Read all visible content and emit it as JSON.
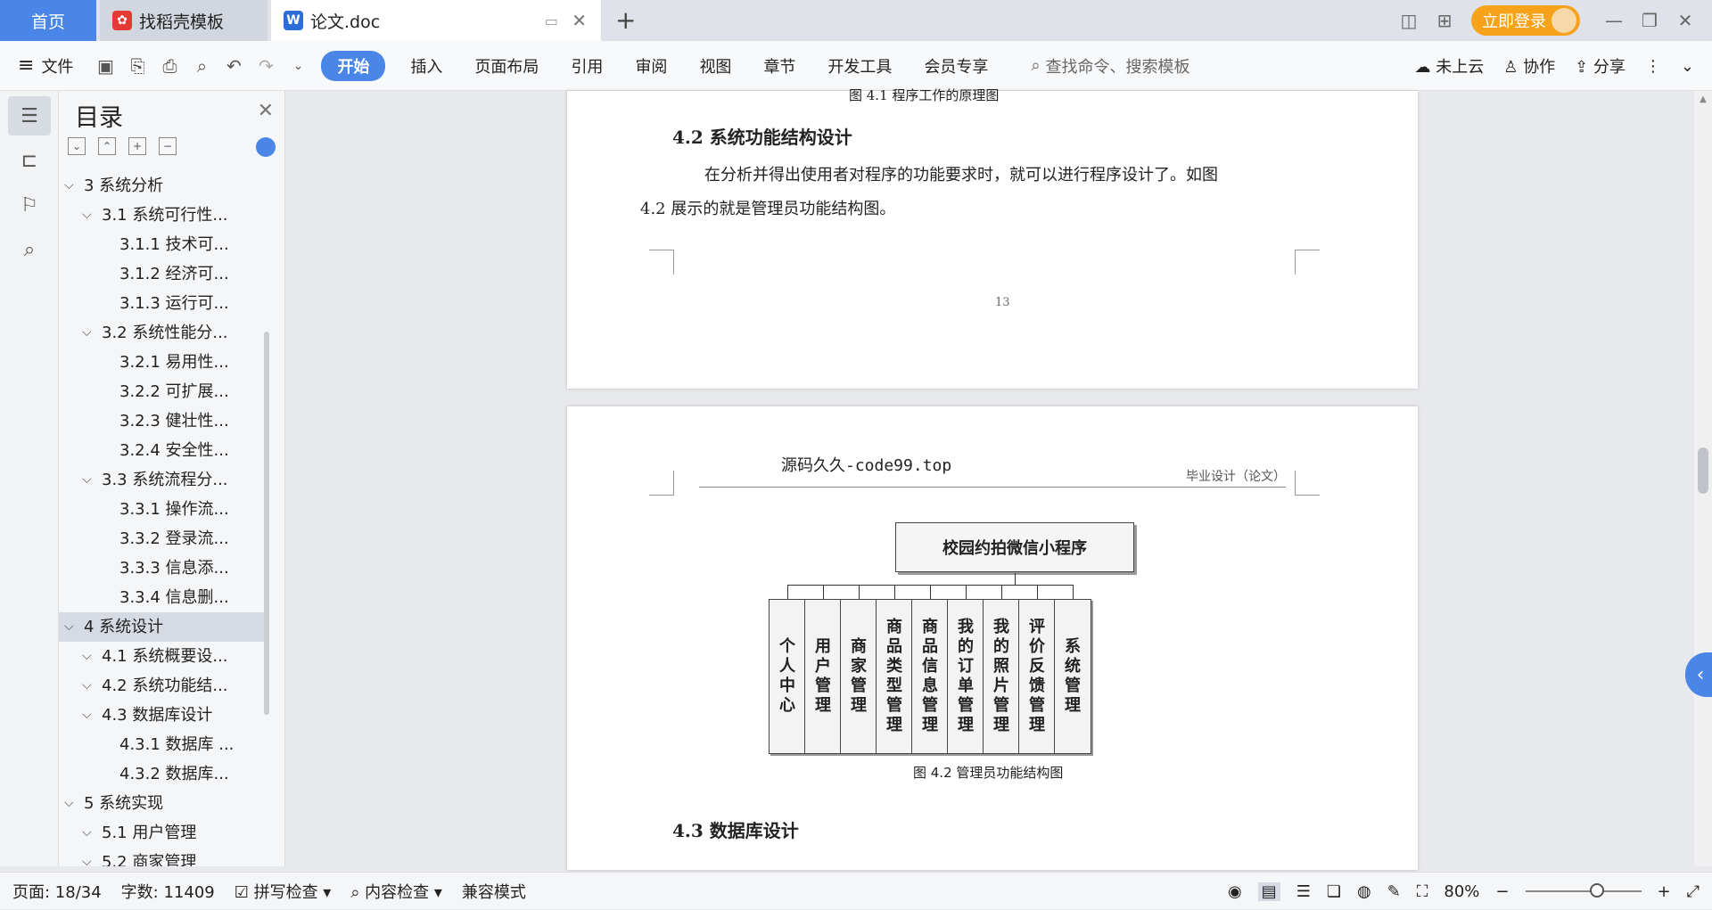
{
  "tabs": {
    "home": "首页",
    "template": "找稻壳模板",
    "document": "论文.doc"
  },
  "titlebar": {
    "login_label": "立即登录"
  },
  "toolbar": {
    "file_label": "文件",
    "menus": [
      "开始",
      "插入",
      "页面布局",
      "引用",
      "审阅",
      "视图",
      "章节",
      "开发工具",
      "会员专享"
    ],
    "search_placeholder": "查找命令、搜索模板",
    "cloud_label": "未上云",
    "collab_label": "协作",
    "share_label": "分享"
  },
  "toc": {
    "title": "目录",
    "items": [
      {
        "label": "3  系统分析",
        "level": 0,
        "expanded": true
      },
      {
        "label": "3.1  系统可行性...",
        "level": 1,
        "expanded": true
      },
      {
        "label": "3.1.1  技术可...",
        "level": 2
      },
      {
        "label": "3.1.2  经济可...",
        "level": 2
      },
      {
        "label": "3.1.3  运行可...",
        "level": 2
      },
      {
        "label": "3.2  系统性能分...",
        "level": 1,
        "expanded": true
      },
      {
        "label": "3.2.1  易用性...",
        "level": 2
      },
      {
        "label": "3.2.2  可扩展...",
        "level": 2
      },
      {
        "label": "3.2.3  健壮性...",
        "level": 2
      },
      {
        "label": "3.2.4  安全性...",
        "level": 2
      },
      {
        "label": "3.3  系统流程分...",
        "level": 1,
        "expanded": true
      },
      {
        "label": "3.3.1  操作流...",
        "level": 2
      },
      {
        "label": "3.3.2  登录流...",
        "level": 2
      },
      {
        "label": "3.3.3  信息添...",
        "level": 2
      },
      {
        "label": "3.3.4  信息删...",
        "level": 2
      },
      {
        "label": "4  系统设计",
        "level": 0,
        "expanded": true,
        "selected": true
      },
      {
        "label": "4.1  系统概要设...",
        "level": 1
      },
      {
        "label": "4.2  系统功能结...",
        "level": 1
      },
      {
        "label": "4.3  数据库设计",
        "level": 1,
        "expanded": true
      },
      {
        "label": "4.3.1  数据库 ...",
        "level": 2
      },
      {
        "label": "4.3.2  数据库...",
        "level": 2
      },
      {
        "label": "5  系统实现",
        "level": 0,
        "expanded": true
      },
      {
        "label": "5.1  用户管理",
        "level": 1
      },
      {
        "label": "5.2  商家管理",
        "level": 1
      }
    ]
  },
  "doc": {
    "prev_caption": "图 4.1  程序工作的原理图",
    "section_42": "4.2  系统功能结构设计",
    "para_42_line1": "在分析并得出使用者对程序的功能要求时，就可以进行程序设计了。如图",
    "para_42_line2": "4.2 展示的就是管理员功能结构图。",
    "page_number": "13",
    "header_source": "源码久久-code99.top",
    "header_right": "毕业设计（论文）",
    "chart_root": "校园约拍微信小程序",
    "chart_leaves": [
      "个人中心",
      "用户管理",
      "商家管理",
      "商品类型管理",
      "商品信息管理",
      "我的订单管理",
      "我的照片管理",
      "评价反馈管理",
      "系统管理"
    ],
    "figure_caption": "图 4.2  管理员功能结构图",
    "section_43": "4.3  数据库设计"
  },
  "status": {
    "page": "页面: 18/34",
    "words": "字数: 11409",
    "spell": "拼写检查",
    "content_check": "内容检查",
    "compat": "兼容模式",
    "zoom": "80%"
  },
  "colors": {
    "accent": "#4a86e8",
    "login": "#f7a21b"
  }
}
